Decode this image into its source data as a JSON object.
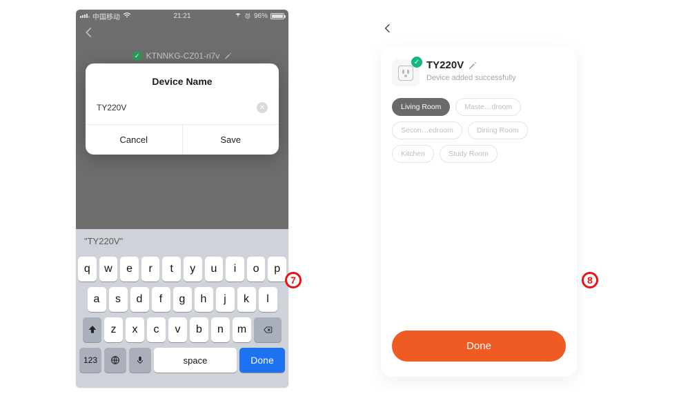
{
  "left": {
    "status": {
      "carrier": "中国移动",
      "time": "21:21",
      "battery_pct": "96%"
    },
    "behind_device_label": "KTNNKG-CZ01-ri7v",
    "dialog": {
      "title": "Device Name",
      "value": "TY220V",
      "cancel": "Cancel",
      "save": "Save"
    },
    "keyboard": {
      "suggestion": "\"TY220V\"",
      "row1": [
        "q",
        "w",
        "e",
        "r",
        "t",
        "y",
        "u",
        "i",
        "o",
        "p"
      ],
      "row2": [
        "a",
        "s",
        "d",
        "f",
        "g",
        "h",
        "j",
        "k",
        "l"
      ],
      "row3": [
        "z",
        "x",
        "c",
        "v",
        "b",
        "n",
        "m"
      ],
      "num_key": "123",
      "space": "space",
      "done": "Done"
    }
  },
  "right": {
    "device_name": "TY220V",
    "device_sub": "Device added successfully",
    "rooms": [
      "Living Room",
      "Maste…droom",
      "Secon…edroom",
      "Dining Room",
      "Kitchen",
      "Study Room"
    ],
    "selected_room_index": 0,
    "done": "Done"
  },
  "steps": {
    "s7": "7",
    "s8": "8"
  }
}
